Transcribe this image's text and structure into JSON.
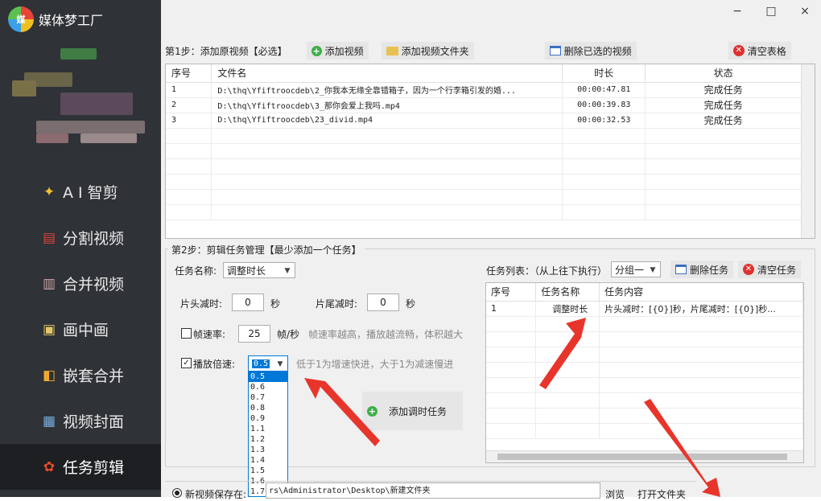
{
  "app": {
    "name": "媒体梦工厂",
    "logo_text": "媒"
  },
  "nav": [
    {
      "label": "A I 智剪",
      "icon": "ai-wand-icon",
      "glyph": "✦"
    },
    {
      "label": "分割视频",
      "icon": "split-layers-icon",
      "glyph": "▤"
    },
    {
      "label": "合并视频",
      "icon": "merge-icon",
      "glyph": "▥"
    },
    {
      "label": "画中画",
      "icon": "picture-in-picture-icon",
      "glyph": "▣"
    },
    {
      "label": "嵌套合并",
      "icon": "nest-merge-icon",
      "glyph": "◧"
    },
    {
      "label": "视频封面",
      "icon": "cover-image-icon",
      "glyph": "▦"
    },
    {
      "label": "任务剪辑",
      "icon": "flower-gear-icon",
      "glyph": "✿"
    }
  ],
  "window": {
    "minimize": "−",
    "maximize": "□",
    "close": "×"
  },
  "step1": {
    "label": "第1步：添加原视频【必选】",
    "add_video": "添加视频",
    "add_folder": "添加视频文件夹",
    "delete_selected": "删除已选的视频",
    "clear_table": "清空表格",
    "columns": [
      "序号",
      "文件名",
      "时长",
      "状态"
    ],
    "rows": [
      [
        "1",
        "D:\\thq\\Yfiftroocdeb\\2_你我本无缘全靠错箱子，因为一个行李箱引发的婚...",
        "00:00:47.81",
        "完成任务"
      ],
      [
        "2",
        "D:\\thq\\Yfiftroocdeb\\3_那你会爱上我吗.mp4",
        "00:00:39.83",
        "完成任务"
      ],
      [
        "3",
        "D:\\thq\\Yfiftroocdeb\\23_divid.mp4",
        "00:00:32.53",
        "完成任务"
      ]
    ]
  },
  "step2": {
    "label": "第2步：剪辑任务管理【最少添加一个任务】",
    "task_name_label": "任务名称:",
    "task_name_value": "调整时长",
    "head_cut_label": "片头减时:",
    "head_cut_value": "0",
    "tail_cut_label": "片尾减时:",
    "tail_cut_value": "0",
    "sec": "秒",
    "framerate_label": "帧速率:",
    "framerate_value": "25",
    "framerate_unit": "帧/秒",
    "framerate_hint": "帧速率越高，播放越流畅，体积越大",
    "speed_label": "播放倍速:",
    "speed_value": "0.5",
    "speed_hint": "低于1为增速快进，大于1为减速慢进",
    "speed_options": [
      "0.5",
      "0.6",
      "0.7",
      "0.8",
      "0.9",
      "1.1",
      "1.2",
      "1.3",
      "1.4",
      "1.5",
      "1.6",
      "1.7"
    ],
    "add_task": "添加调时任务",
    "task_list_label": "任务列表：（从上往下执行）",
    "group_value": "分组一",
    "delete_task": "删除任务",
    "clear_tasks": "清空任务",
    "task_columns": [
      "序号",
      "任务名称",
      "任务内容"
    ],
    "task_rows": [
      [
        "1",
        "调整时长",
        "片头减时：[{0}]秒，片尾减时：[{0}]秒..."
      ]
    ]
  },
  "output": {
    "save_label": "新视频保存在:",
    "path": "rs\\Administrator\\Desktop\\新建文件夹",
    "browse": "浏览",
    "open_folder": "打开文件夹"
  }
}
